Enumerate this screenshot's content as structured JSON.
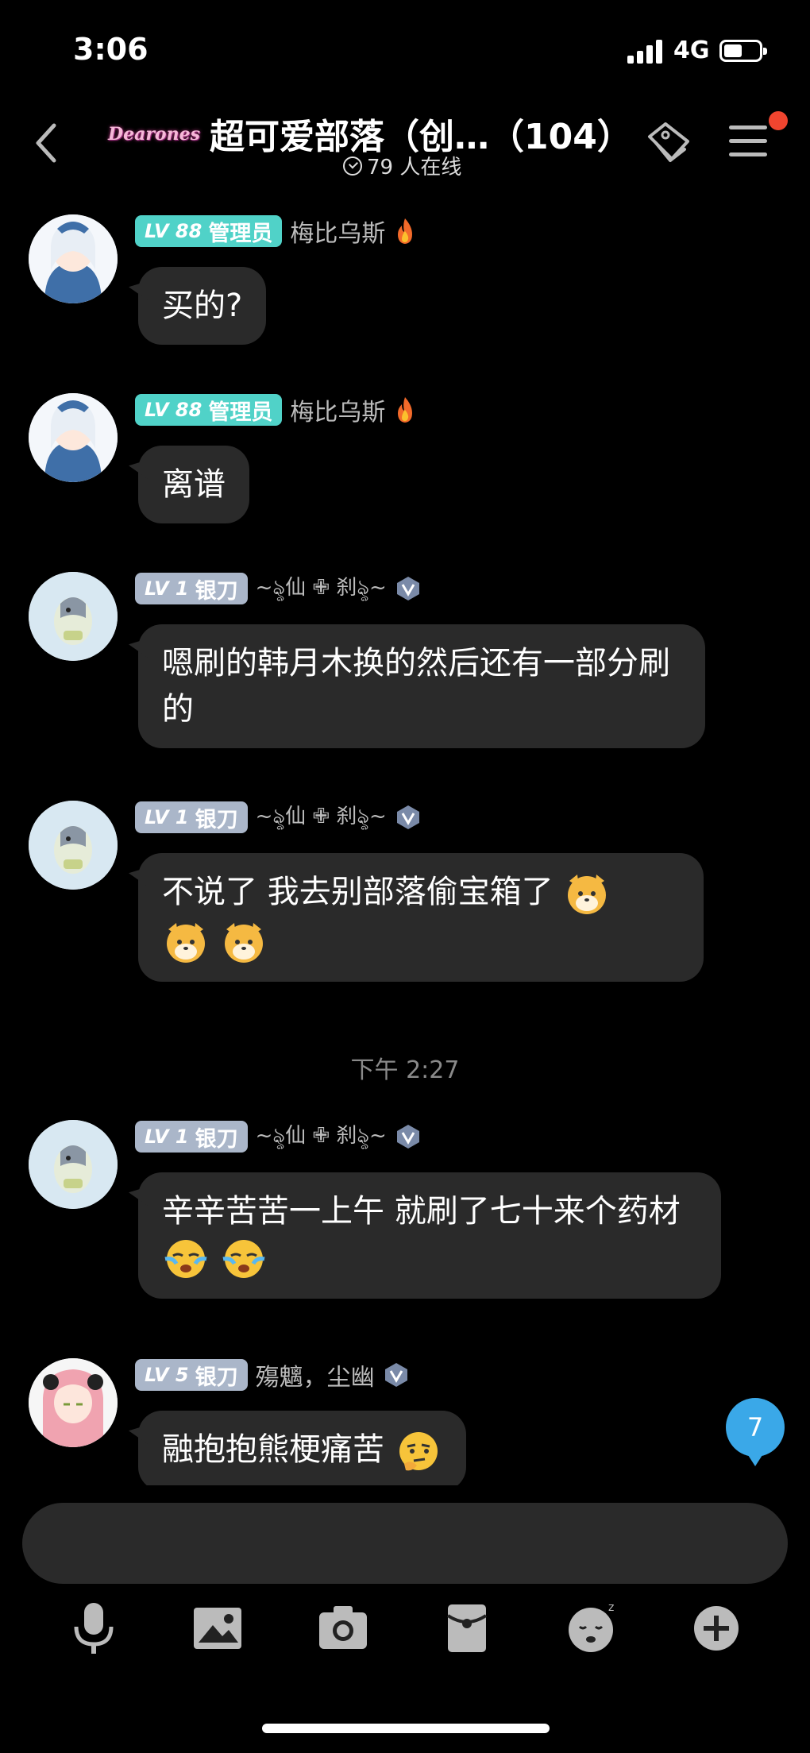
{
  "status_bar": {
    "time": "3:06",
    "network": "4G"
  },
  "header": {
    "brand": "Dearones",
    "title": "超可爱部落（创…（104）",
    "online_text": "79 人在线"
  },
  "messages": [
    {
      "level": "LV 88",
      "role": "管理员",
      "name": "梅比乌斯",
      "text": "买的?"
    },
    {
      "level": "LV 88",
      "role": "管理员",
      "name": "梅比乌斯",
      "text": "离谱"
    },
    {
      "level": "LV 1",
      "role": "银刀",
      "name": "~ৡ仙 ✙ 刹ৡ~",
      "text": "嗯刷的韩月木换的然后还有一部分刷的"
    },
    {
      "level": "LV 1",
      "role": "银刀",
      "name": "~ৡ仙 ✙ 刹ৡ~",
      "text": "不说了 我去别部落偷宝箱了"
    },
    {
      "level": "LV 1",
      "role": "银刀",
      "name": "~ৡ仙 ✙ 刹ৡ~",
      "text": "辛辛苦苦一上午 就刷了七十来个药材"
    },
    {
      "level": "LV 5",
      "role": "银刀",
      "name": "殤魑，尘幽",
      "text": "融抱抱熊梗痛苦"
    }
  ],
  "time_divider": "下午 2:27",
  "unread_count": "7",
  "icons": [
    "back-icon",
    "tag-icon",
    "menu-icon",
    "mic-icon",
    "image-icon",
    "camera-icon",
    "red-packet-icon",
    "emoji-icon",
    "add-icon"
  ],
  "colors": {
    "admin_badge": "#50d2c8",
    "silver_badge": "#aab6c9",
    "bubble": "#2a2a2a",
    "unread_badge": "#3aa8e8",
    "notification": "#f0452f"
  }
}
